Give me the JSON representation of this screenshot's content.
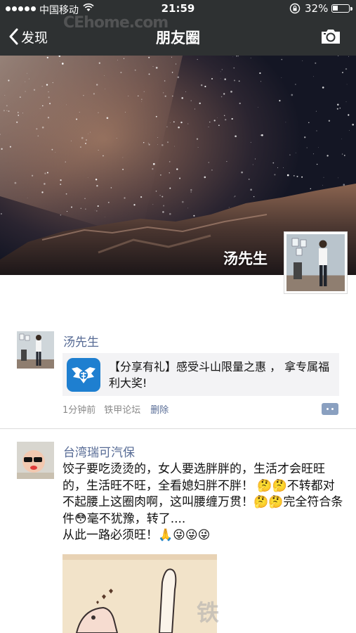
{
  "status_bar": {
    "carrier": "中国移动",
    "time": "21:59",
    "battery": "32%",
    "battery_level": 0.32
  },
  "header": {
    "back_label": "发现",
    "title": "朋友圈",
    "watermark": "CEhome.com"
  },
  "cover": {
    "user_name": "汤先生"
  },
  "posts": [
    {
      "author": "汤先生",
      "share_text": "【分享有礼】感受斗山限量之惠 ， 拿专属福利大奖!",
      "time_ago": "1分钟前",
      "source": "铁甲论坛",
      "delete_label": "删除"
    },
    {
      "author": "台湾瑞可汽保",
      "text": "饺子要吃烫烫的，女人要选胖胖的，生活才会旺旺的，生活旺不旺，全看媳妇胖不胖！ 🤔🤔不转都对不起腰上这圈肉啊，这叫腰缠万贯！🤔🤔完全符合条件😳毫不犹豫，转了....\n从此一路必须旺！🙏😜😜😜"
    }
  ],
  "watermark": "铁"
}
